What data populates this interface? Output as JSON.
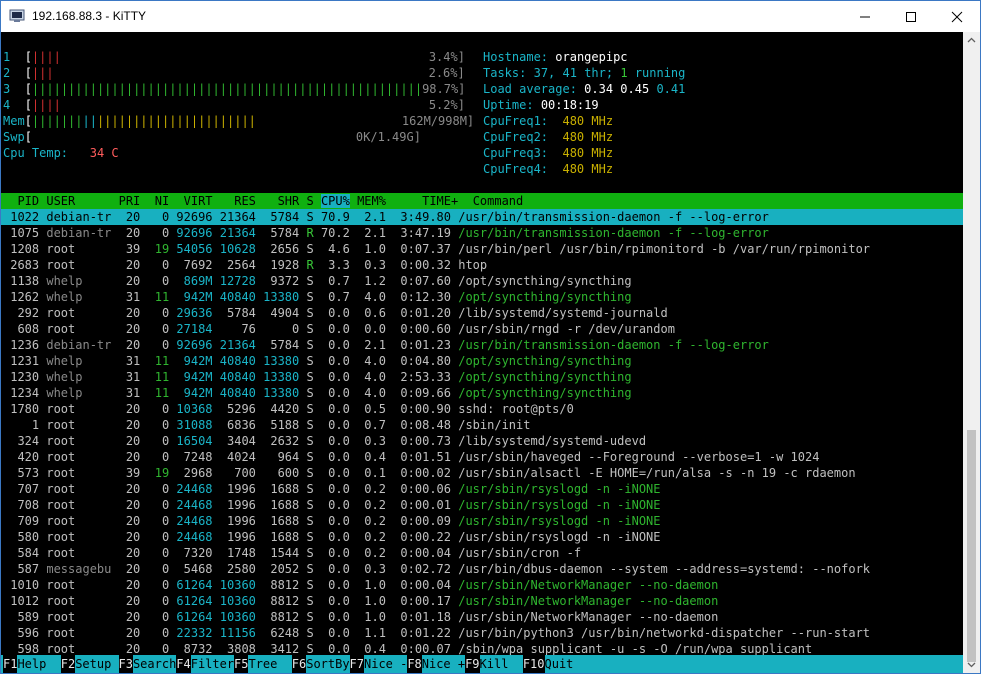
{
  "window": {
    "title": "192.168.88.3 - KiTTY",
    "colors": {
      "accent": "#18b0c0",
      "header": "#10b010",
      "background": "#000000"
    }
  },
  "meters": {
    "cpu": [
      {
        "label": "1",
        "bar": "[|||| ",
        "pct": "3.4%]"
      },
      {
        "label": "2",
        "bar": "[|||  ",
        "pct": "2.6%]"
      },
      {
        "label": "3",
        "bar": "[||||||||||||||||||||||||||||||||||||||||||||||||||||||",
        "pct": "98.7%]"
      },
      {
        "label": "4",
        "bar": "[||||  ",
        "pct": "5.2%]"
      }
    ],
    "mem": {
      "label": "Mem",
      "bar": "[||||||||||||||||||||||||||||||||||||||||||",
      "value": "162M/998M]"
    },
    "swp": {
      "label": "Swp",
      "bar": "[",
      "value": "0K/1.49G]"
    },
    "cpu_temp": {
      "label": "Cpu Temp:",
      "value": "34 C"
    }
  },
  "info": {
    "hostname_label": "Hostname:",
    "hostname": "orangepipc",
    "tasks_label": "Tasks:",
    "tasks": "37,",
    "thr": "41",
    "thr_label": "thr;",
    "running": "1",
    "running_label": "running",
    "load_label": "Load average:",
    "load1": "0.34",
    "load5": "0.45",
    "load15": "0.41",
    "uptime_label": "Uptime:",
    "uptime": "00:18:19",
    "freqs": [
      {
        "label": "CpuFreq1:",
        "value": "480 MHz"
      },
      {
        "label": "CpuFreq2:",
        "value": "480 MHz"
      },
      {
        "label": "CpuFreq3:",
        "value": "480 MHz"
      },
      {
        "label": "CpuFreq4:",
        "value": "480 MHz"
      }
    ]
  },
  "table": {
    "headers": {
      "pid": "PID",
      "user": "USER",
      "pri": "PRI",
      "ni": "NI",
      "virt": "VIRT",
      "res": "RES",
      "shr": "SHR",
      "s": "S",
      "cpu": "CPU%",
      "mem": "MEM%",
      "time": "TIME+",
      "command": "Command"
    },
    "rows": [
      {
        "pid": "1022",
        "user": "debian-tr",
        "pri": "20",
        "ni": "0",
        "virt": "92696",
        "res": "21364",
        "shr": "5784",
        "s": "S",
        "cpu": "70.9",
        "mem": "2.1",
        "time": "3:49.80",
        "command": "/usr/bin/transmission-daemon -f --log-error"
      },
      {
        "pid": "1075",
        "user": "debian-tr",
        "pri": "20",
        "ni": "0",
        "virt": "92696",
        "res": "21364",
        "shr": "5784",
        "s": "R",
        "cpu": "70.2",
        "mem": "2.1",
        "time": "3:47.19",
        "command": "/usr/bin/transmission-daemon -f --log-error"
      },
      {
        "pid": "1208",
        "user": "root",
        "pri": "39",
        "ni": "19",
        "virt": "54056",
        "res": "10628",
        "shr": "2656",
        "s": "S",
        "cpu": "4.6",
        "mem": "1.0",
        "time": "0:07.37",
        "command": "/usr/bin/perl /usr/bin/rpimonitord -b /var/run/rpimonitor"
      },
      {
        "pid": "2683",
        "user": "root",
        "pri": "20",
        "ni": "0",
        "virt": "7692",
        "res": "2564",
        "shr": "1928",
        "s": "R",
        "cpu": "3.3",
        "mem": "0.3",
        "time": "0:00.32",
        "command": "htop"
      },
      {
        "pid": "1138",
        "user": "whelp",
        "pri": "20",
        "ni": "0",
        "virt": "869M",
        "res": "12728",
        "shr": "9372",
        "s": "S",
        "cpu": "0.7",
        "mem": "1.2",
        "time": "0:07.60",
        "command": "/opt/syncthing/syncthing"
      },
      {
        "pid": "1262",
        "user": "whelp",
        "pri": "31",
        "ni": "11",
        "virt": "942M",
        "res": "40840",
        "shr": "13380",
        "s": "S",
        "cpu": "0.7",
        "mem": "4.0",
        "time": "0:12.30",
        "command": "/opt/syncthing/syncthing"
      },
      {
        "pid": "292",
        "user": "root",
        "pri": "20",
        "ni": "0",
        "virt": "29636",
        "res": "5784",
        "shr": "4904",
        "s": "S",
        "cpu": "0.0",
        "mem": "0.6",
        "time": "0:01.20",
        "command": "/lib/systemd/systemd-journald"
      },
      {
        "pid": "608",
        "user": "root",
        "pri": "20",
        "ni": "0",
        "virt": "27184",
        "res": "76",
        "shr": "0",
        "s": "S",
        "cpu": "0.0",
        "mem": "0.0",
        "time": "0:00.60",
        "command": "/usr/sbin/rngd -r /dev/urandom"
      },
      {
        "pid": "1236",
        "user": "debian-tr",
        "pri": "20",
        "ni": "0",
        "virt": "92696",
        "res": "21364",
        "shr": "5784",
        "s": "S",
        "cpu": "0.0",
        "mem": "2.1",
        "time": "0:01.23",
        "command": "/usr/bin/transmission-daemon -f --log-error"
      },
      {
        "pid": "1231",
        "user": "whelp",
        "pri": "31",
        "ni": "11",
        "virt": "942M",
        "res": "40840",
        "shr": "13380",
        "s": "S",
        "cpu": "0.0",
        "mem": "4.0",
        "time": "0:04.80",
        "command": "/opt/syncthing/syncthing"
      },
      {
        "pid": "1230",
        "user": "whelp",
        "pri": "31",
        "ni": "11",
        "virt": "942M",
        "res": "40840",
        "shr": "13380",
        "s": "S",
        "cpu": "0.0",
        "mem": "4.0",
        "time": "2:53.33",
        "command": "/opt/syncthing/syncthing"
      },
      {
        "pid": "1234",
        "user": "whelp",
        "pri": "31",
        "ni": "11",
        "virt": "942M",
        "res": "40840",
        "shr": "13380",
        "s": "S",
        "cpu": "0.0",
        "mem": "4.0",
        "time": "0:09.66",
        "command": "/opt/syncthing/syncthing"
      },
      {
        "pid": "1780",
        "user": "root",
        "pri": "20",
        "ni": "0",
        "virt": "10368",
        "res": "5296",
        "shr": "4420",
        "s": "S",
        "cpu": "0.0",
        "mem": "0.5",
        "time": "0:00.90",
        "command": "sshd: root@pts/0"
      },
      {
        "pid": "1",
        "user": "root",
        "pri": "20",
        "ni": "0",
        "virt": "31088",
        "res": "6836",
        "shr": "5188",
        "s": "S",
        "cpu": "0.0",
        "mem": "0.7",
        "time": "0:08.48",
        "command": "/sbin/init"
      },
      {
        "pid": "324",
        "user": "root",
        "pri": "20",
        "ni": "0",
        "virt": "16504",
        "res": "3404",
        "shr": "2632",
        "s": "S",
        "cpu": "0.0",
        "mem": "0.3",
        "time": "0:00.73",
        "command": "/lib/systemd/systemd-udevd"
      },
      {
        "pid": "420",
        "user": "root",
        "pri": "20",
        "ni": "0",
        "virt": "7248",
        "res": "4024",
        "shr": "964",
        "s": "S",
        "cpu": "0.0",
        "mem": "0.4",
        "time": "0:01.51",
        "command": "/usr/sbin/haveged --Foreground --verbose=1 -w 1024"
      },
      {
        "pid": "573",
        "user": "root",
        "pri": "39",
        "ni": "19",
        "virt": "2968",
        "res": "700",
        "shr": "600",
        "s": "S",
        "cpu": "0.0",
        "mem": "0.1",
        "time": "0:00.02",
        "command": "/usr/sbin/alsactl -E HOME=/run/alsa -s -n 19 -c rdaemon"
      },
      {
        "pid": "707",
        "user": "root",
        "pri": "20",
        "ni": "0",
        "virt": "24468",
        "res": "1996",
        "shr": "1688",
        "s": "S",
        "cpu": "0.0",
        "mem": "0.2",
        "time": "0:00.06",
        "command": "/usr/sbin/rsyslogd -n -iNONE"
      },
      {
        "pid": "708",
        "user": "root",
        "pri": "20",
        "ni": "0",
        "virt": "24468",
        "res": "1996",
        "shr": "1688",
        "s": "S",
        "cpu": "0.0",
        "mem": "0.2",
        "time": "0:00.01",
        "command": "/usr/sbin/rsyslogd -n -iNONE"
      },
      {
        "pid": "709",
        "user": "root",
        "pri": "20",
        "ni": "0",
        "virt": "24468",
        "res": "1996",
        "shr": "1688",
        "s": "S",
        "cpu": "0.0",
        "mem": "0.2",
        "time": "0:00.09",
        "command": "/usr/sbin/rsyslogd -n -iNONE"
      },
      {
        "pid": "580",
        "user": "root",
        "pri": "20",
        "ni": "0",
        "virt": "24468",
        "res": "1996",
        "shr": "1688",
        "s": "S",
        "cpu": "0.0",
        "mem": "0.2",
        "time": "0:00.22",
        "command": "/usr/sbin/rsyslogd -n -iNONE"
      },
      {
        "pid": "584",
        "user": "root",
        "pri": "20",
        "ni": "0",
        "virt": "7320",
        "res": "1748",
        "shr": "1544",
        "s": "S",
        "cpu": "0.0",
        "mem": "0.2",
        "time": "0:00.04",
        "command": "/usr/sbin/cron -f"
      },
      {
        "pid": "587",
        "user": "messagebu",
        "pri": "20",
        "ni": "0",
        "virt": "5468",
        "res": "2580",
        "shr": "2052",
        "s": "S",
        "cpu": "0.0",
        "mem": "0.3",
        "time": "0:02.72",
        "command": "/usr/bin/dbus-daemon --system --address=systemd: --nofork"
      },
      {
        "pid": "1010",
        "user": "root",
        "pri": "20",
        "ni": "0",
        "virt": "61264",
        "res": "10360",
        "shr": "8812",
        "s": "S",
        "cpu": "0.0",
        "mem": "1.0",
        "time": "0:00.04",
        "command": "/usr/sbin/NetworkManager --no-daemon"
      },
      {
        "pid": "1012",
        "user": "root",
        "pri": "20",
        "ni": "0",
        "virt": "61264",
        "res": "10360",
        "shr": "8812",
        "s": "S",
        "cpu": "0.0",
        "mem": "1.0",
        "time": "0:00.17",
        "command": "/usr/sbin/NetworkManager --no-daemon"
      },
      {
        "pid": "589",
        "user": "root",
        "pri": "20",
        "ni": "0",
        "virt": "61264",
        "res": "10360",
        "shr": "8812",
        "s": "S",
        "cpu": "0.0",
        "mem": "1.0",
        "time": "0:01.18",
        "command": "/usr/sbin/NetworkManager --no-daemon"
      },
      {
        "pid": "596",
        "user": "root",
        "pri": "20",
        "ni": "0",
        "virt": "22332",
        "res": "11156",
        "shr": "6248",
        "s": "S",
        "cpu": "0.0",
        "mem": "1.1",
        "time": "0:01.22",
        "command": "/usr/bin/python3 /usr/bin/networkd-dispatcher --run-start"
      },
      {
        "pid": "598",
        "user": "root",
        "pri": "20",
        "ni": "0",
        "virt": "8732",
        "res": "3808",
        "shr": "3412",
        "s": "S",
        "cpu": "0.0",
        "mem": "0.4",
        "time": "0:00.07",
        "command": "/sbin/wpa_supplicant -u -s -O /run/wpa_supplicant"
      }
    ]
  },
  "footer": [
    {
      "key": "F1",
      "label": "Help  "
    },
    {
      "key": "F2",
      "label": "Setup "
    },
    {
      "key": "F3",
      "label": "Search"
    },
    {
      "key": "F4",
      "label": "Filter"
    },
    {
      "key": "F5",
      "label": "Tree  "
    },
    {
      "key": "F6",
      "label": "SortBy"
    },
    {
      "key": "F7",
      "label": "Nice -"
    },
    {
      "key": "F8",
      "label": "Nice +"
    },
    {
      "key": "F9",
      "label": "Kill  "
    },
    {
      "key": "F10",
      "label": "Quit"
    }
  ]
}
